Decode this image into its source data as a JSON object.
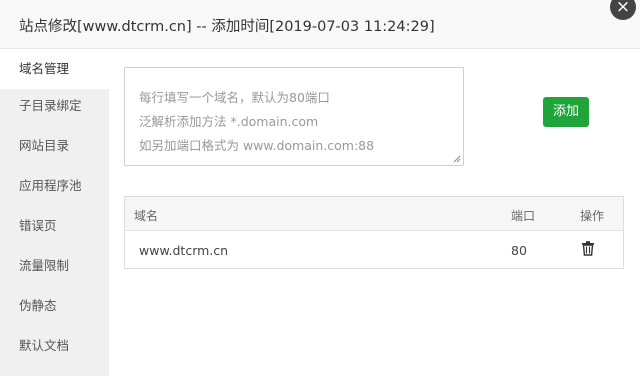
{
  "dialog": {
    "title": "站点修改[www.dtcrm.cn] -- 添加时间[2019-07-03 11:24:29]",
    "close_glyph": "×"
  },
  "sidebar": {
    "items": [
      {
        "label": "域名管理",
        "active": true
      },
      {
        "label": "子目录绑定"
      },
      {
        "label": "网站目录"
      },
      {
        "label": "应用程序池"
      },
      {
        "label": "错误页"
      },
      {
        "label": "流量限制"
      },
      {
        "label": "伪静态"
      },
      {
        "label": "默认文档"
      }
    ]
  },
  "domain_form": {
    "placeholder_lines": [
      "每行填写一个域名，默认为80端口",
      "泛解析添加方法 *.domain.com",
      "如另加端口格式为 www.domain.com:88"
    ],
    "add_label": "添加"
  },
  "domain_table": {
    "headers": [
      "域名",
      "端口",
      "操作"
    ],
    "rows": [
      {
        "domain": "www.dtcrm.cn",
        "port": "80",
        "action_icon": "trash-icon"
      }
    ]
  },
  "colors": {
    "accent": "#20a53a",
    "sidebar_bg": "#f0f0f0",
    "titlebar_bg": "#f8f8f8"
  }
}
